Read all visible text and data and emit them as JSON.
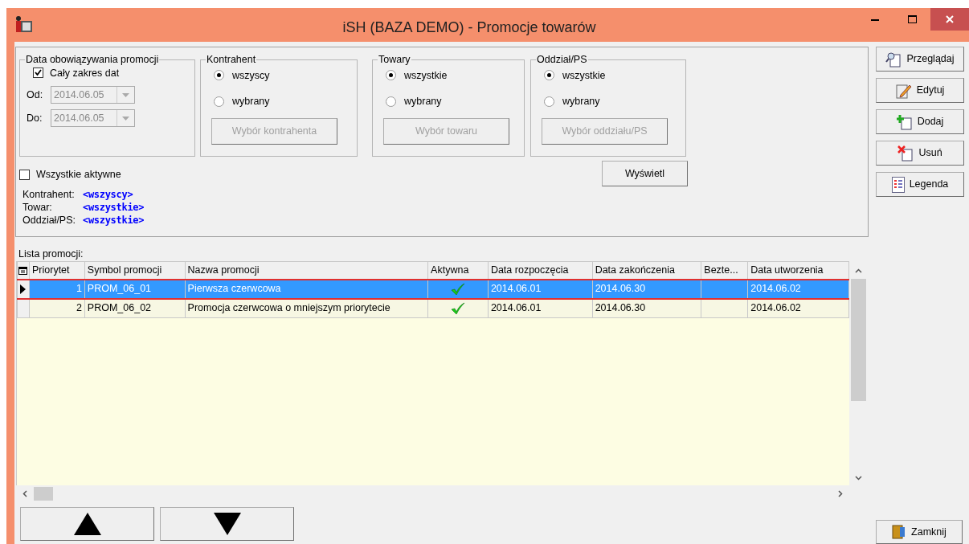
{
  "window": {
    "title": "iSH (BAZA DEMO) - Promocje towarów"
  },
  "date_group": {
    "title": "Data obowiązywania promocji",
    "all_dates": {
      "label": "Cały zakres dat",
      "checked": true
    },
    "from": {
      "label": "Od:",
      "value": "2014.06.05",
      "disabled": true
    },
    "to": {
      "label": "Do:",
      "value": "2014.06.05",
      "disabled": true
    }
  },
  "filter_groups": [
    {
      "title": "Kontrahent",
      "options": [
        {
          "label": "wszyscy",
          "selected": true
        },
        {
          "label": "wybrany",
          "selected": false
        }
      ],
      "button": {
        "label": "Wybór kontrahenta",
        "disabled": true
      }
    },
    {
      "title": "Towary",
      "options": [
        {
          "label": "wszystkie",
          "selected": true
        },
        {
          "label": "wybrany",
          "selected": false
        }
      ],
      "button": {
        "label": "Wybór towaru",
        "disabled": true
      }
    },
    {
      "title": "Oddział/PS",
      "options": [
        {
          "label": "wszystkie",
          "selected": true
        },
        {
          "label": "wybrany",
          "selected": false
        }
      ],
      "button": {
        "label": "Wybór oddziału/PS",
        "disabled": true
      }
    }
  ],
  "all_active": {
    "label": "Wszystkie aktywne",
    "checked": false
  },
  "show_button": "Wyświetl",
  "summary": [
    {
      "label": "Kontrahent:",
      "value": "<wszyscy>"
    },
    {
      "label": "Towar:",
      "value": "<wszystkie>"
    },
    {
      "label": "Oddział/PS:",
      "value": "<wszystkie>"
    }
  ],
  "list": {
    "title": "Lista promocji:",
    "columns": [
      "Priorytet",
      "Symbol promocji",
      "Nazwa promocji",
      "Aktywna",
      "Data rozpoczęcia",
      "Data zakończenia",
      "Bezte...",
      "Data utworzenia"
    ],
    "rows": [
      {
        "priority": "1",
        "symbol": "PROM_06_01",
        "name": "Pierwsza czerwcowa",
        "active": true,
        "start": "2014.06.01",
        "end": "2014.06.30",
        "created": "2014.06.02",
        "selected": true
      },
      {
        "priority": "2",
        "symbol": "PROM_06_02",
        "name": "Promocja czerwcowa o mniejszym priorytecie",
        "active": true,
        "start": "2014.06.01",
        "end": "2014.06.30",
        "created": "2014.06.02",
        "selected": false
      }
    ]
  },
  "side_buttons": [
    "Przeglądaj",
    "Edytuj",
    "Dodaj",
    "Usuń",
    "Legenda"
  ],
  "close_button": "Zamknij"
}
